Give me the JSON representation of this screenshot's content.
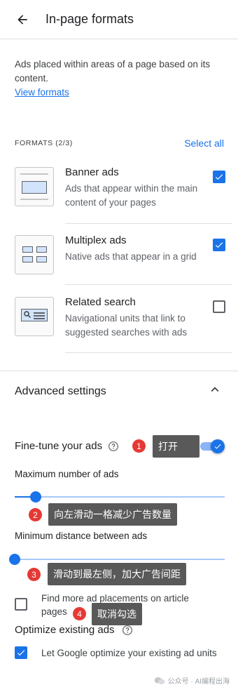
{
  "header": {
    "title": "In-page formats"
  },
  "intro": {
    "text": "Ads placed within areas of a page based on its content.",
    "link": "View formats"
  },
  "formats": {
    "count_label": "FORMATS (2/3)",
    "select_all": "Select all",
    "items": [
      {
        "title": "Banner ads",
        "desc": "Ads that appear within the main content of your pages",
        "checked": true,
        "icon": "banner-thumbnail"
      },
      {
        "title": "Multiplex ads",
        "desc": "Native ads that appear in a grid",
        "checked": true,
        "icon": "multiplex-grid-thumbnail"
      },
      {
        "title": "Related search",
        "desc": "Navigational units that link to suggested searches with ads",
        "checked": false,
        "icon": "related-search-thumbnail"
      }
    ]
  },
  "advanced": {
    "title": "Advanced settings",
    "fine_tune": {
      "label": "Fine-tune your ads",
      "toggle_on": true
    },
    "max_ads": {
      "label": "Maximum number of ads",
      "value_fraction": 0.1
    },
    "min_distance": {
      "label": "Minimum distance between ads",
      "value_fraction": 0.0
    },
    "find_more": {
      "label": "Find more ad placements on article pages",
      "checked": false
    },
    "optimize": {
      "title": "Optimize existing ads",
      "label": "Let Google optimize your existing ad units",
      "checked": true
    }
  },
  "annotations": [
    {
      "number": "1",
      "text": "打开"
    },
    {
      "number": "2",
      "text": "向左滑动一格减少广告数量"
    },
    {
      "number": "3",
      "text": "滑动到最左侧，加大广告间距"
    },
    {
      "number": "4",
      "text": "取消勾选"
    }
  ],
  "watermark": {
    "text": "公众号 · AI编程出海"
  },
  "colors": {
    "accent": "#1a73e8",
    "badge": "#e53935",
    "tooltip": "#595959"
  }
}
